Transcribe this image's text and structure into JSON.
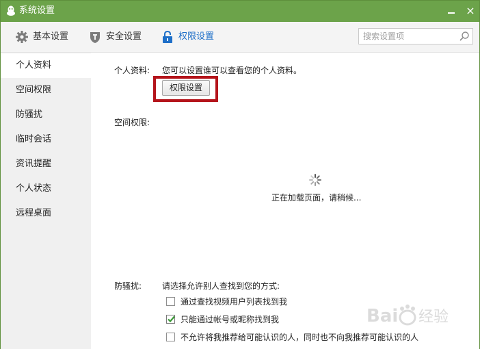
{
  "window": {
    "title": "系统设置",
    "minimize_icon": "minimize-icon",
    "close_label": "×"
  },
  "toolbar": {
    "tabs": [
      {
        "label": "基本设置",
        "icon": "gear-icon"
      },
      {
        "label": "安全设置",
        "icon": "shield-icon"
      },
      {
        "label": "权限设置",
        "icon": "lock-icon",
        "active": true
      }
    ],
    "search_placeholder": "搜索设置项"
  },
  "sidebar": {
    "items": [
      {
        "label": "个人资料",
        "active": true
      },
      {
        "label": "空间权限"
      },
      {
        "label": "防骚扰"
      },
      {
        "label": "临时会话"
      },
      {
        "label": "资讯提醒"
      },
      {
        "label": "个人状态"
      },
      {
        "label": "远程桌面"
      }
    ]
  },
  "main": {
    "profile": {
      "label": "个人资料:",
      "description": "您可以设置谁可以查看您的个人资料。",
      "button_label": "权限设置"
    },
    "space": {
      "label": "空间权限:",
      "loading_text": "正在加载页面，请稍候..."
    },
    "harassment": {
      "label": "防骚扰:",
      "description": "请选择允许别人查找到您的方式:",
      "options": [
        {
          "label": "通过查找视频用户列表找到我",
          "checked": false
        },
        {
          "label": "只能通过帐号或昵称找到我",
          "checked": true
        },
        {
          "label": "不允许将我推荐给可能认识的人，同时也不向我推荐可能认识的人",
          "checked": false
        }
      ]
    }
  },
  "watermark": {
    "text": "Baidu 经验"
  },
  "colors": {
    "titlebar": "#6ca34a",
    "accent": "#1e6fc8",
    "highlight": "#b4141b",
    "check": "#3a9a36"
  }
}
